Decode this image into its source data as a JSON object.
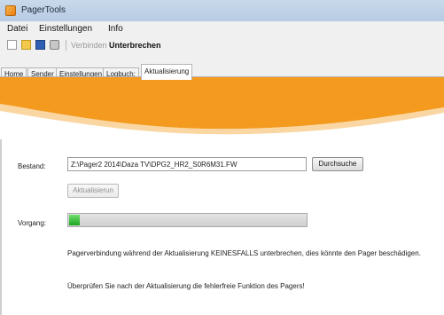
{
  "window": {
    "title": "PagerTools"
  },
  "menu": {
    "items": [
      "Datei",
      "Einstellungen",
      "Info"
    ]
  },
  "toolbar": {
    "connect_label": "Verbinden",
    "interrupt_label": "Unterbrechen"
  },
  "tabs": [
    {
      "label": "Home"
    },
    {
      "label": "Sender"
    },
    {
      "label": "Einstellungen"
    },
    {
      "label": "Logbuch:"
    },
    {
      "label": "Aktualisierung"
    }
  ],
  "active_tab": "Aktualisierung",
  "update": {
    "bestand_label": "Bestand:",
    "file_path": "Z:\\Pager2 2014\\Daza TV\\DPG2_HR2_S0R6M31.FW",
    "browse_label": "Durchsuche",
    "update_button_label": "Aktualisierun",
    "vorgang_label": "Vorgang:",
    "progress_fraction": 0.045,
    "progress_color": "#2fb52f",
    "warning_text": "Pagerverbindung während der Aktualisierung KEINESFALLS unterbrechen, dies könnte den Pager beschädigen.",
    "check_text": "Überprüfen Sie nach der Aktualisierung die fehlerfreie Funktion des Pagers!"
  },
  "colors": {
    "banner_orange": "#f39a1f",
    "titlebar": "#c3d4ea"
  }
}
